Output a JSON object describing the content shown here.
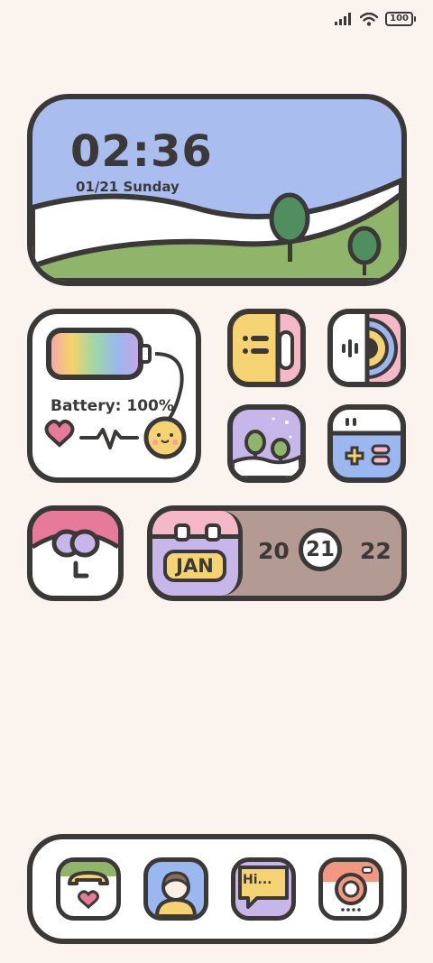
{
  "status_bar": {
    "battery": "100",
    "icons": [
      "signal-icon",
      "wifi-icon",
      "battery-icon"
    ]
  },
  "clock_widget": {
    "time": "02:36",
    "date": "01/21 Sunday"
  },
  "battery_widget": {
    "label": "Battery: 100%"
  },
  "date_widget": {
    "month": "JAN",
    "year_prefix": "20",
    "day": "21",
    "year_suffix": "22"
  },
  "bubble_icon": {
    "text": "Hi..."
  },
  "dock": {
    "apps": [
      "phone-icon",
      "contacts-icon",
      "messages-icon",
      "camera-icon"
    ]
  },
  "colors": {
    "background": "#fbf3ee",
    "outline": "#3b3937",
    "sky": "#a9bdee",
    "grass": "#8fb56b",
    "date_panel": "#b39a93"
  }
}
